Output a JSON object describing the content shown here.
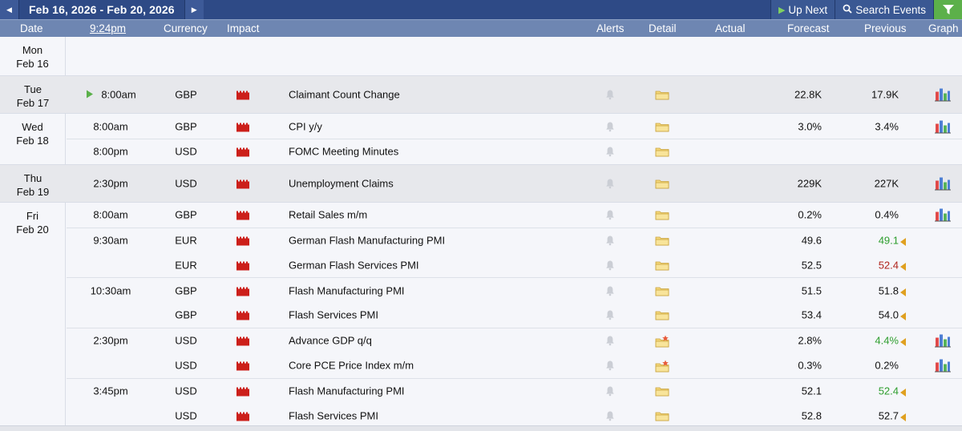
{
  "toolbar": {
    "date_range": "Feb 16, 2026 - Feb 20, 2026",
    "up_next_label": "Up Next",
    "search_events_label": "Search Events"
  },
  "columns": {
    "date": "Date",
    "time": "9:24pm",
    "currency": "Currency",
    "impact": "Impact",
    "alerts": "Alerts",
    "detail": "Detail",
    "actual": "Actual",
    "forecast": "Forecast",
    "previous": "Previous",
    "graph": "Graph"
  },
  "colors": {
    "topbar": "#2e4a86",
    "header": "#6e86b2",
    "impact_high": "#cc1f1a",
    "revised_better": "#2e9e2e",
    "revised_worse": "#b0241c"
  },
  "days": [
    {
      "dow": "Mon",
      "date": "Feb 16",
      "alt": false,
      "rows": []
    },
    {
      "dow": "Tue",
      "date": "Feb 17",
      "alt": true,
      "rows": [
        {
          "time": "8:00am",
          "currency": "GBP",
          "event": "Claimant Count Change",
          "forecast": "22.8K",
          "previous": "17.9K",
          "prev_revised": "",
          "graph": true,
          "detail": "folder",
          "live": true
        }
      ]
    },
    {
      "dow": "Wed",
      "date": "Feb 18",
      "alt": false,
      "rows": [
        {
          "time": "8:00am",
          "currency": "GBP",
          "event": "CPI y/y",
          "forecast": "3.0%",
          "previous": "3.4%",
          "prev_revised": "",
          "graph": true,
          "detail": "folder"
        },
        {
          "time": "8:00pm",
          "currency": "USD",
          "event": "FOMC Meeting Minutes",
          "forecast": "",
          "previous": "",
          "prev_revised": "",
          "graph": false,
          "detail": "folder"
        }
      ]
    },
    {
      "dow": "Thu",
      "date": "Feb 19",
      "alt": true,
      "rows": [
        {
          "time": "2:30pm",
          "currency": "USD",
          "event": "Unemployment Claims",
          "forecast": "229K",
          "previous": "227K",
          "prev_revised": "",
          "graph": true,
          "detail": "folder"
        }
      ]
    },
    {
      "dow": "Fri",
      "date": "Feb 20",
      "alt": false,
      "rows": [
        {
          "time": "8:00am",
          "currency": "GBP",
          "event": "Retail Sales m/m",
          "forecast": "0.2%",
          "previous": "0.4%",
          "prev_revised": "",
          "graph": true,
          "detail": "folder"
        },
        {
          "time": "9:30am",
          "currency": "EUR",
          "event": "German Flash Manufacturing PMI",
          "forecast": "49.6",
          "previous": "49.1",
          "prev_revised": "better",
          "graph": false,
          "detail": "folder"
        },
        {
          "time": "",
          "currency": "EUR",
          "event": "German Flash Services PMI",
          "forecast": "52.5",
          "previous": "52.4",
          "prev_revised": "worse",
          "graph": false,
          "detail": "folder"
        },
        {
          "time": "10:30am",
          "currency": "GBP",
          "event": "Flash Manufacturing PMI",
          "forecast": "51.5",
          "previous": "51.8",
          "prev_revised": "neutral",
          "graph": false,
          "detail": "folder"
        },
        {
          "time": "",
          "currency": "GBP",
          "event": "Flash Services PMI",
          "forecast": "53.4",
          "previous": "54.0",
          "prev_revised": "neutral",
          "graph": false,
          "detail": "folder"
        },
        {
          "time": "2:30pm",
          "currency": "USD",
          "event": "Advance GDP q/q",
          "forecast": "2.8%",
          "previous": "4.4%",
          "prev_revised": "better",
          "graph": true,
          "detail": "folder-star"
        },
        {
          "time": "",
          "currency": "USD",
          "event": "Core PCE Price Index m/m",
          "forecast": "0.3%",
          "previous": "0.2%",
          "prev_revised": "",
          "graph": true,
          "detail": "folder-star"
        },
        {
          "time": "3:45pm",
          "currency": "USD",
          "event": "Flash Manufacturing PMI",
          "forecast": "52.1",
          "previous": "52.4",
          "prev_revised": "better",
          "graph": false,
          "detail": "folder"
        },
        {
          "time": "",
          "currency": "USD",
          "event": "Flash Services PMI",
          "forecast": "52.8",
          "previous": "52.7",
          "prev_revised": "neutral",
          "graph": false,
          "detail": "folder"
        }
      ]
    }
  ]
}
